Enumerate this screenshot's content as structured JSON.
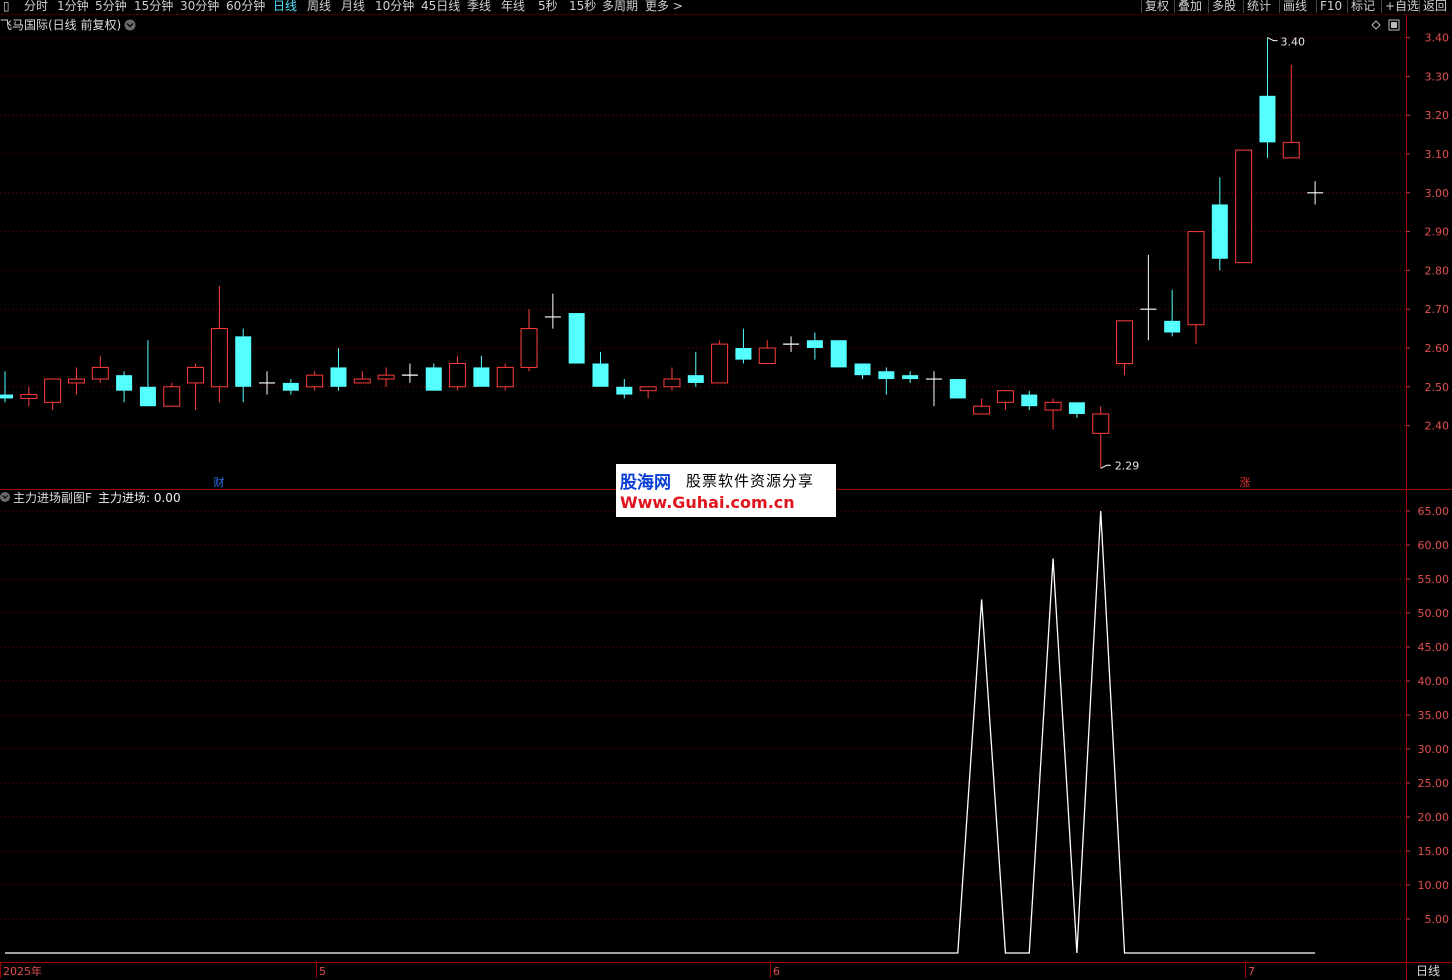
{
  "toolbar": {
    "periods": [
      "分时",
      "1分钟",
      "5分钟",
      "15分钟",
      "30分钟",
      "60分钟",
      "日线",
      "周线",
      "月线",
      "10分钟",
      "45日线",
      "季线",
      "年线",
      "5秒",
      "15秒",
      "多周期",
      "更多 >"
    ],
    "active_period": "日线",
    "right_buttons": [
      "复权",
      "叠加",
      "多股",
      "统计",
      "画线",
      "F10",
      "标记",
      "+自选",
      "返回"
    ]
  },
  "main_chart": {
    "title": "飞马国际(日线 前复权)",
    "y_ticks": [
      "3.40",
      "3.30",
      "3.20",
      "3.10",
      "3.00",
      "2.90",
      "2.80",
      "2.70",
      "2.60",
      "2.50",
      "2.40"
    ],
    "high_label": "3.40",
    "low_label": "2.29",
    "markers": [
      "财",
      "涨"
    ]
  },
  "sub_chart": {
    "title": "主力进场副图F",
    "value_label": "主力进场: 0.00",
    "y_ticks": [
      "65.00",
      "60.00",
      "55.00",
      "50.00",
      "45.00",
      "40.00",
      "35.00",
      "30.00",
      "25.00",
      "20.00",
      "15.00",
      "10.00",
      "5.00"
    ]
  },
  "x_axis": {
    "labels": [
      "2025年",
      "5",
      "6",
      "7"
    ],
    "period_label": "日线"
  },
  "watermark": {
    "line1_brand": "股海网",
    "line1_rest": "股票软件资源分享",
    "line2": "Www.Guhai.com.cn"
  },
  "colors": {
    "up": "#ff3c3c",
    "down": "#54ffff",
    "flat": "#ffffff",
    "grid": "#7a0000",
    "axis_text": "#e05050",
    "active": "#4fe0ff"
  },
  "chart_data": [
    {
      "type": "candlestick",
      "title": "飞马国际(日线 前复权)",
      "ylim": [
        2.29,
        3.42
      ],
      "candles": [
        {
          "o": 2.48,
          "c": 2.47,
          "h": 2.54,
          "l": 2.46
        },
        {
          "o": 2.47,
          "c": 2.48,
          "h": 2.5,
          "l": 2.45
        },
        {
          "o": 2.46,
          "c": 2.52,
          "h": 2.52,
          "l": 2.44
        },
        {
          "o": 2.51,
          "c": 2.52,
          "h": 2.55,
          "l": 2.48
        },
        {
          "o": 2.52,
          "c": 2.55,
          "h": 2.58,
          "l": 2.51
        },
        {
          "o": 2.53,
          "c": 2.49,
          "h": 2.54,
          "l": 2.46
        },
        {
          "o": 2.5,
          "c": 2.45,
          "h": 2.62,
          "l": 2.45
        },
        {
          "o": 2.45,
          "c": 2.5,
          "h": 2.51,
          "l": 2.45
        },
        {
          "o": 2.51,
          "c": 2.55,
          "h": 2.56,
          "l": 2.44
        },
        {
          "o": 2.5,
          "c": 2.65,
          "h": 2.76,
          "l": 2.46
        },
        {
          "o": 2.63,
          "c": 2.5,
          "h": 2.65,
          "l": 2.46
        },
        {
          "o": 2.51,
          "c": 2.51,
          "h": 2.54,
          "l": 2.48
        },
        {
          "o": 2.51,
          "c": 2.49,
          "h": 2.52,
          "l": 2.48
        },
        {
          "o": 2.5,
          "c": 2.53,
          "h": 2.54,
          "l": 2.49
        },
        {
          "o": 2.55,
          "c": 2.5,
          "h": 2.6,
          "l": 2.49
        },
        {
          "o": 2.51,
          "c": 2.52,
          "h": 2.54,
          "l": 2.51
        },
        {
          "o": 2.52,
          "c": 2.53,
          "h": 2.55,
          "l": 2.5
        },
        {
          "o": 2.53,
          "c": 2.53,
          "h": 2.56,
          "l": 2.51
        },
        {
          "o": 2.55,
          "c": 2.49,
          "h": 2.56,
          "l": 2.49
        },
        {
          "o": 2.5,
          "c": 2.56,
          "h": 2.58,
          "l": 2.49
        },
        {
          "o": 2.55,
          "c": 2.5,
          "h": 2.58,
          "l": 2.5
        },
        {
          "o": 2.5,
          "c": 2.55,
          "h": 2.56,
          "l": 2.49
        },
        {
          "o": 2.55,
          "c": 2.65,
          "h": 2.7,
          "l": 2.54
        },
        {
          "o": 2.68,
          "c": 2.68,
          "h": 2.74,
          "l": 2.65
        },
        {
          "o": 2.69,
          "c": 2.56,
          "h": 2.69,
          "l": 2.56
        },
        {
          "o": 2.56,
          "c": 2.5,
          "h": 2.59,
          "l": 2.5
        },
        {
          "o": 2.5,
          "c": 2.48,
          "h": 2.52,
          "l": 2.47
        },
        {
          "o": 2.49,
          "c": 2.5,
          "h": 2.5,
          "l": 2.47
        },
        {
          "o": 2.5,
          "c": 2.52,
          "h": 2.55,
          "l": 2.49
        },
        {
          "o": 2.53,
          "c": 2.51,
          "h": 2.59,
          "l": 2.5
        },
        {
          "o": 2.51,
          "c": 2.61,
          "h": 2.62,
          "l": 2.51
        },
        {
          "o": 2.6,
          "c": 2.57,
          "h": 2.65,
          "l": 2.56
        },
        {
          "o": 2.56,
          "c": 2.6,
          "h": 2.62,
          "l": 2.56
        },
        {
          "o": 2.61,
          "c": 2.61,
          "h": 2.63,
          "l": 2.59
        },
        {
          "o": 2.62,
          "c": 2.6,
          "h": 2.64,
          "l": 2.57
        },
        {
          "o": 2.62,
          "c": 2.55,
          "h": 2.62,
          "l": 2.55
        },
        {
          "o": 2.56,
          "c": 2.53,
          "h": 2.56,
          "l": 2.52
        },
        {
          "o": 2.54,
          "c": 2.52,
          "h": 2.55,
          "l": 2.48
        },
        {
          "o": 2.53,
          "c": 2.52,
          "h": 2.54,
          "l": 2.51
        },
        {
          "o": 2.52,
          "c": 2.52,
          "h": 2.54,
          "l": 2.45
        },
        {
          "o": 2.52,
          "c": 2.47,
          "h": 2.52,
          "l": 2.47
        },
        {
          "o": 2.43,
          "c": 2.45,
          "h": 2.47,
          "l": 2.43
        },
        {
          "o": 2.46,
          "c": 2.49,
          "h": 2.49,
          "l": 2.44
        },
        {
          "o": 2.48,
          "c": 2.45,
          "h": 2.49,
          "l": 2.44
        },
        {
          "o": 2.44,
          "c": 2.46,
          "h": 2.47,
          "l": 2.39
        },
        {
          "o": 2.46,
          "c": 2.43,
          "h": 2.46,
          "l": 2.42
        },
        {
          "o": 2.38,
          "c": 2.43,
          "h": 2.45,
          "l": 2.29
        },
        {
          "o": 2.56,
          "c": 2.67,
          "h": 2.67,
          "l": 2.53
        },
        {
          "o": 2.7,
          "c": 2.7,
          "h": 2.84,
          "l": 2.62
        },
        {
          "o": 2.67,
          "c": 2.64,
          "h": 2.75,
          "l": 2.63
        },
        {
          "o": 2.66,
          "c": 2.9,
          "h": 2.9,
          "l": 2.61
        },
        {
          "o": 2.97,
          "c": 2.83,
          "h": 3.04,
          "l": 2.8
        },
        {
          "o": 2.82,
          "c": 3.11,
          "h": 3.11,
          "l": 2.82
        },
        {
          "o": 3.25,
          "c": 3.13,
          "h": 3.4,
          "l": 3.09
        },
        {
          "o": 3.09,
          "c": 3.13,
          "h": 3.33,
          "l": 3.09
        },
        {
          "o": 3.0,
          "c": 3.0,
          "h": 3.03,
          "l": 2.97
        }
      ]
    },
    {
      "type": "line",
      "title": "主力进场副图F",
      "series": [
        {
          "name": "主力进场",
          "color": "#ffffff"
        }
      ],
      "ylim": [
        0,
        65
      ],
      "points": [
        [
          0,
          0
        ],
        [
          40,
          0
        ],
        [
          41,
          52
        ],
        [
          42,
          0
        ],
        [
          43,
          0
        ],
        [
          44,
          58
        ],
        [
          45,
          0
        ],
        [
          46,
          65
        ],
        [
          47,
          0
        ],
        [
          55,
          0
        ]
      ]
    }
  ]
}
